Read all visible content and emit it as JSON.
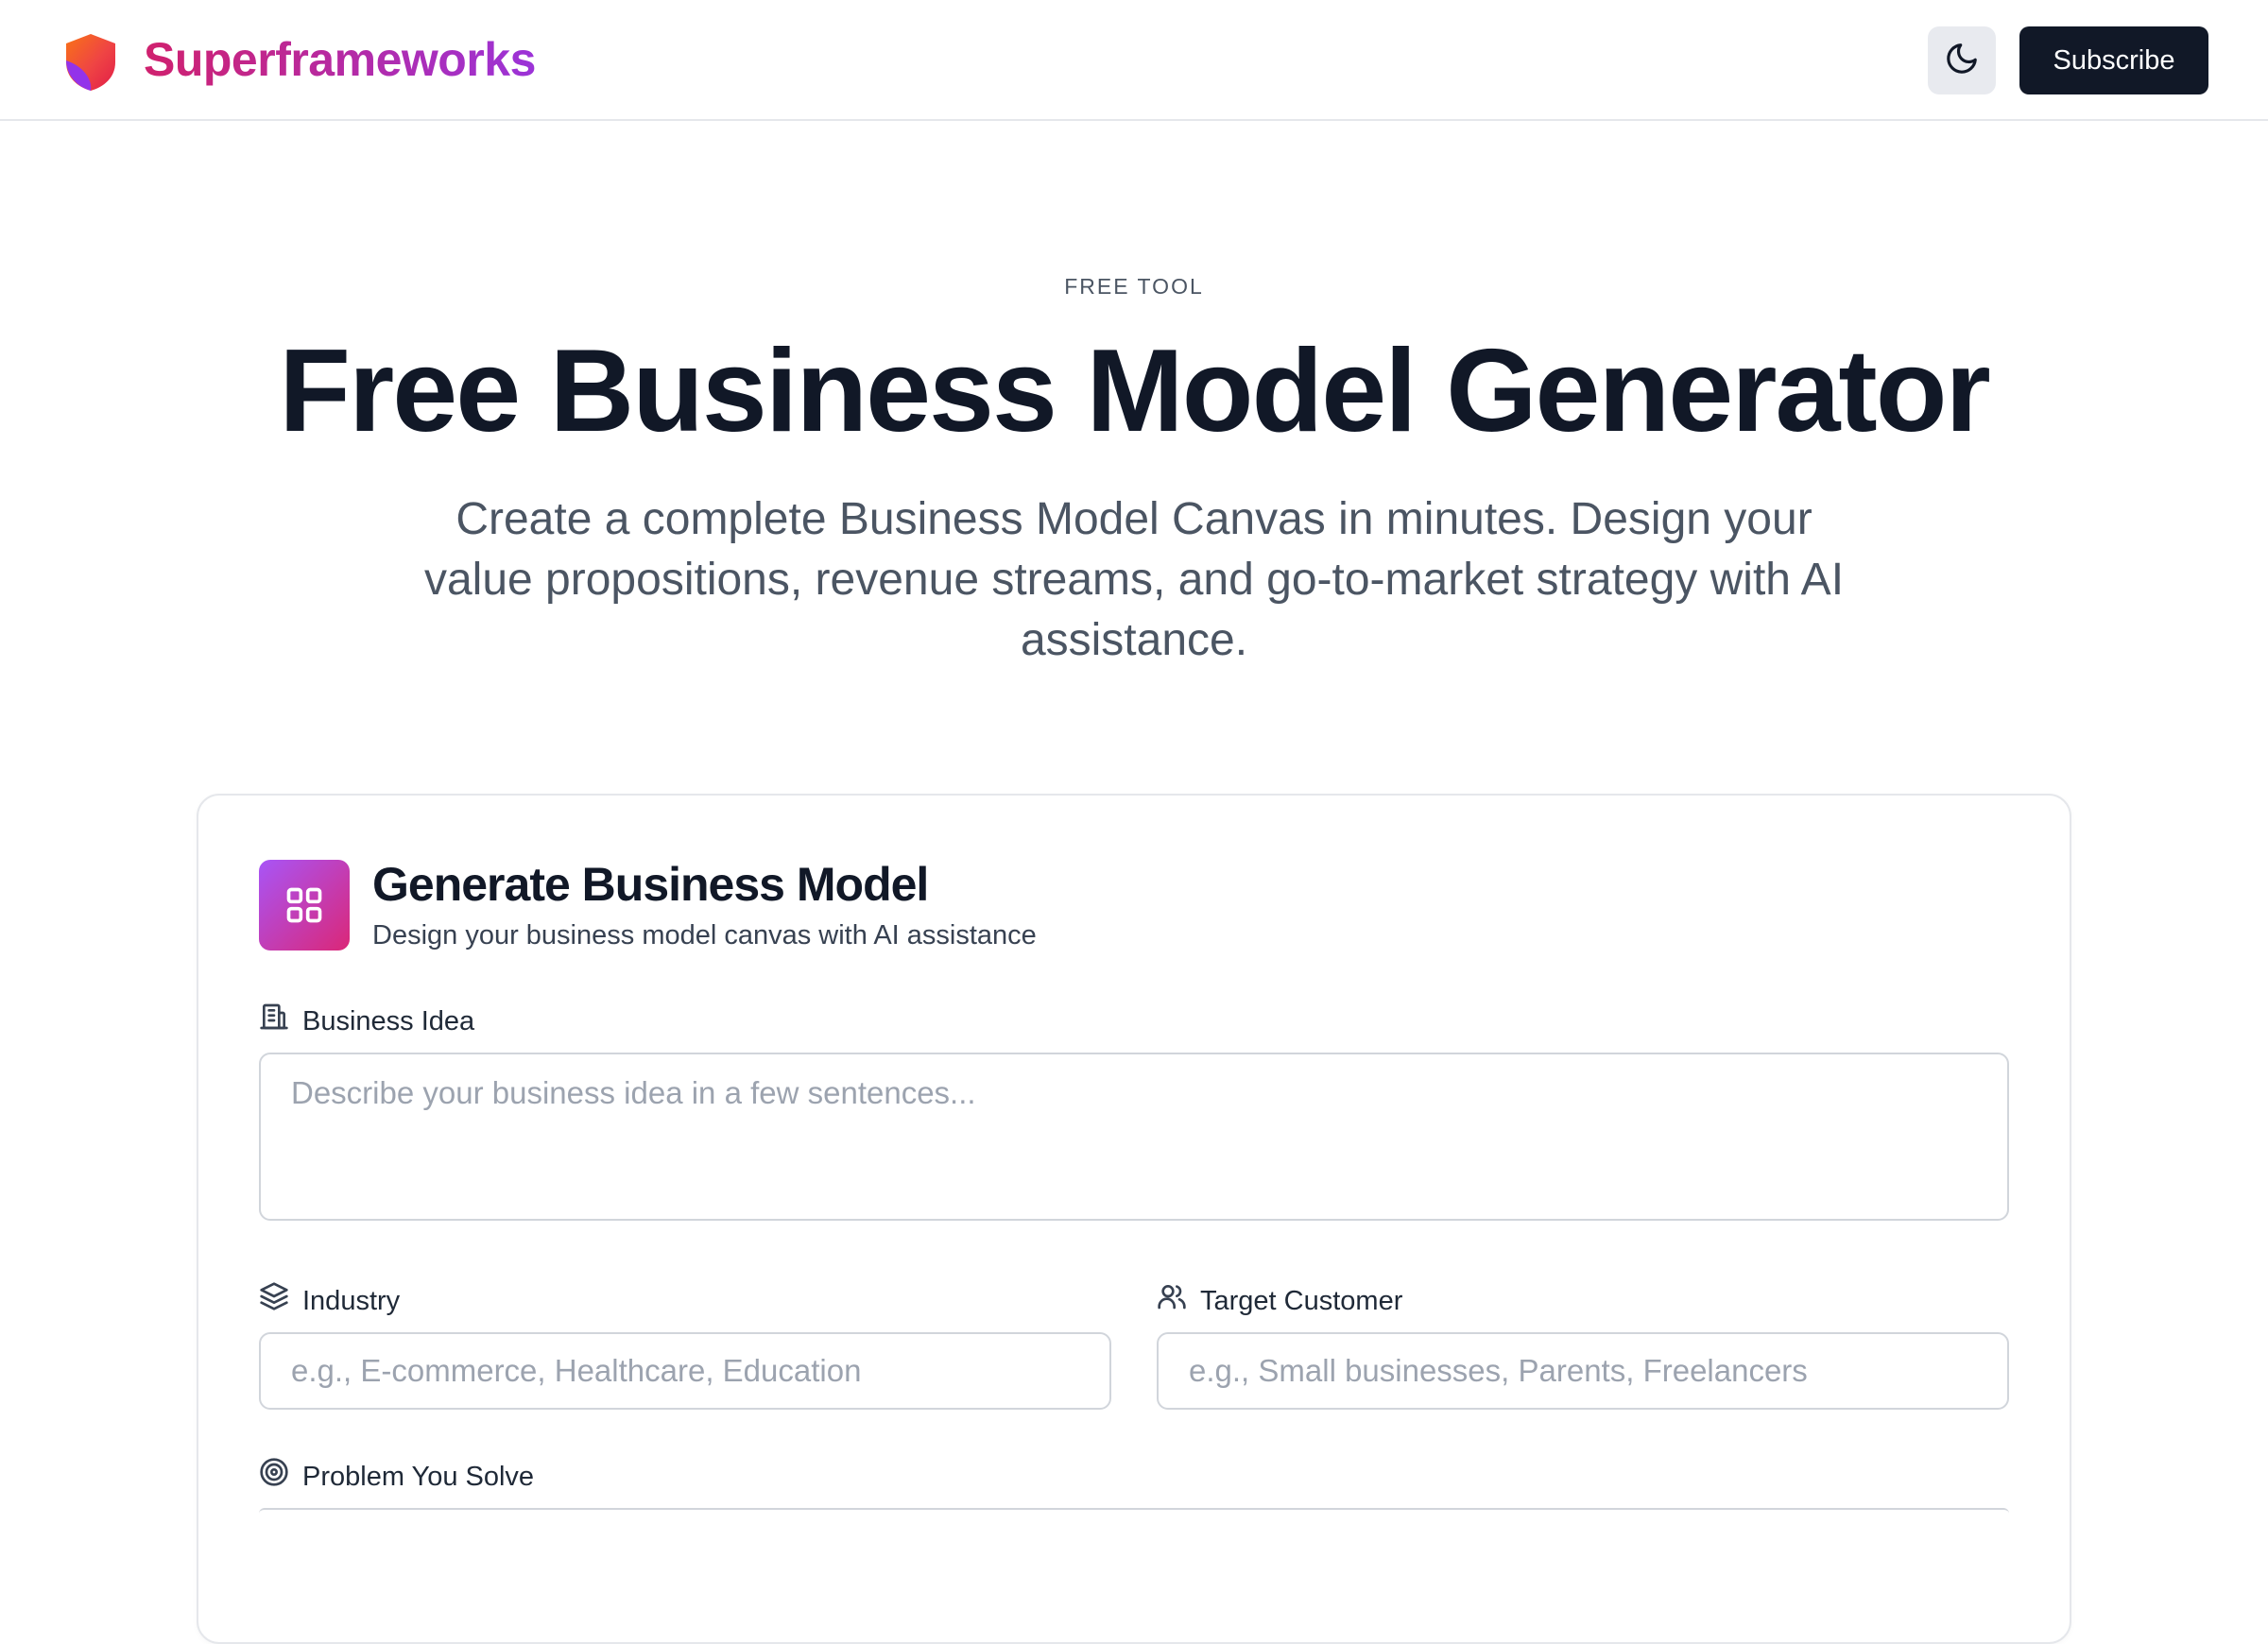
{
  "header": {
    "brand": "Superframeworks",
    "logo_icon": "shield-icon",
    "theme_toggle_icon": "moon-icon",
    "subscribe_label": "Subscribe"
  },
  "hero": {
    "eyebrow": "FREE TOOL",
    "title": "Free Business Model Generator",
    "subtitle": "Create a complete Business Model Canvas in minutes. Design your value propositions, revenue streams, and go-to-market strategy with AI assistance."
  },
  "card": {
    "icon": "grid-icon",
    "title": "Generate Business Model",
    "subtitle": "Design your business model canvas with AI assistance",
    "fields": {
      "business_idea": {
        "label": "Business Idea",
        "icon": "building-icon",
        "value": "",
        "placeholder": "Describe your business idea in a few sentences..."
      },
      "industry": {
        "label": "Industry",
        "icon": "layers-icon",
        "value": "",
        "placeholder": "e.g., E-commerce, Healthcare, Education"
      },
      "target_customer": {
        "label": "Target Customer",
        "icon": "users-icon",
        "value": "",
        "placeholder": "e.g., Small businesses, Parents, Freelancers"
      },
      "problem": {
        "label": "Problem You Solve",
        "icon": "target-icon"
      }
    }
  },
  "colors": {
    "brand_gradient_start": "#d0216e",
    "brand_gradient_end": "#9b33d8",
    "primary_button": "#111827",
    "card_icon_gradient_start": "#a855f7",
    "card_icon_gradient_end": "#db2777"
  }
}
